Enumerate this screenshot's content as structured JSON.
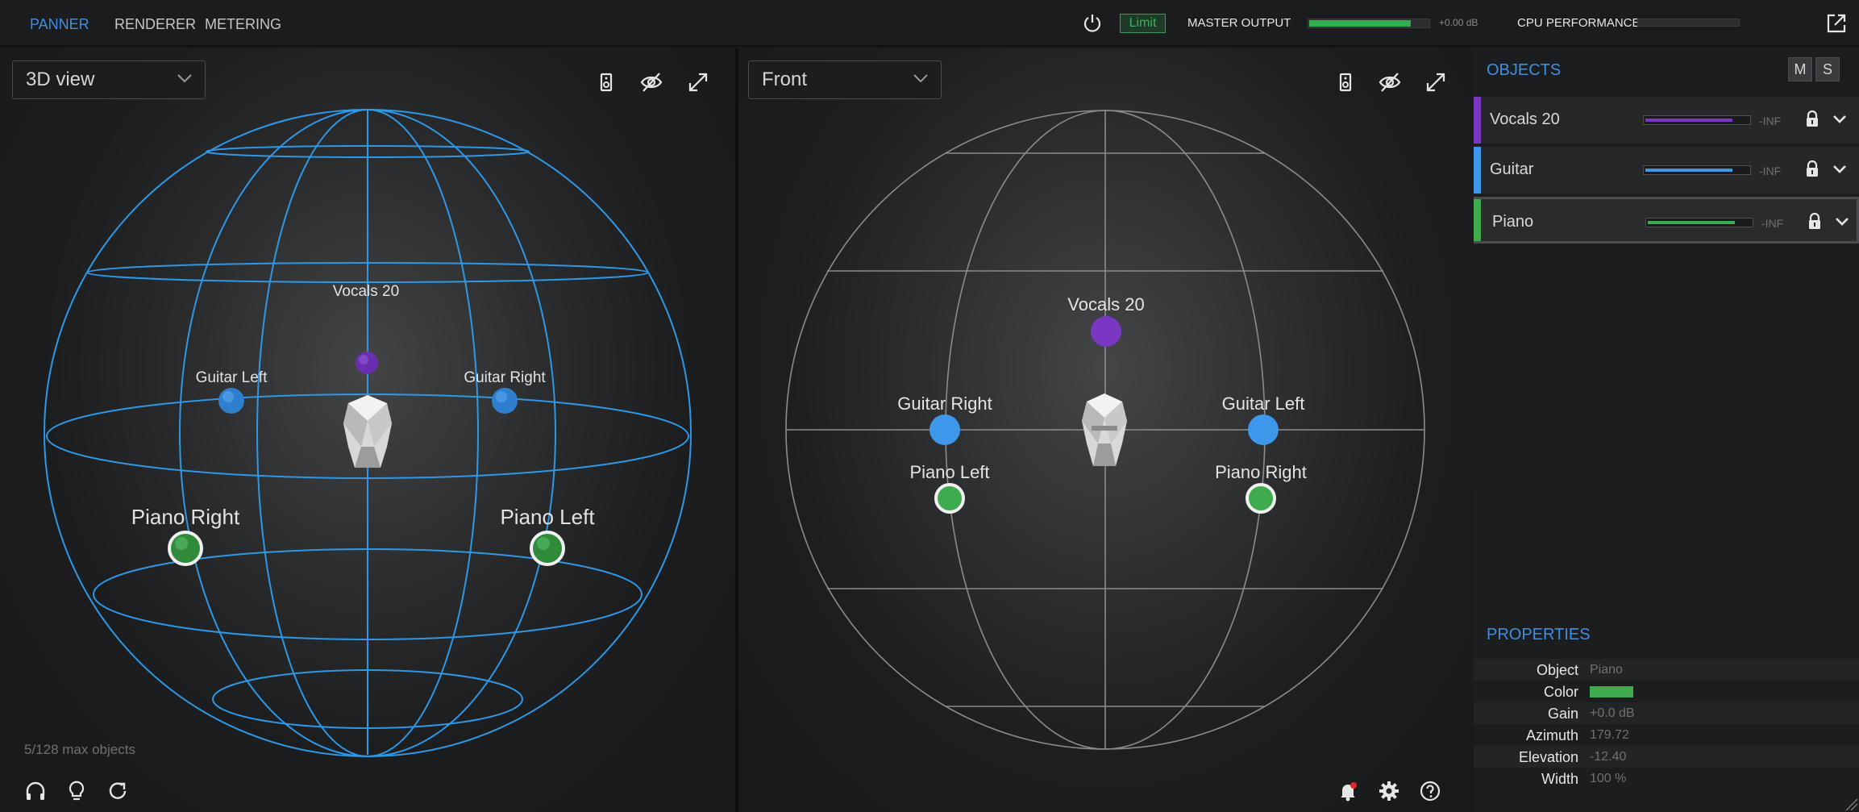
{
  "tabs": [
    {
      "label": "PANNER",
      "active": true
    },
    {
      "label": "RENDERER",
      "active": false
    },
    {
      "label": "METERING",
      "active": false
    }
  ],
  "header": {
    "limit_label": "Limit",
    "master_label": "MASTER OUTPUT",
    "master_level": 0.84,
    "master_db": "+0.00 dB",
    "cpu_label": "CPU PERFORMANCE",
    "cpu_level": 0.0
  },
  "views": {
    "left": {
      "mode": "3D view"
    },
    "right": {
      "mode": "Front"
    }
  },
  "object_count": "5/128 max objects",
  "colors": {
    "accent": "#3f8fe0",
    "vocals": "#7a38c2",
    "guitar": "#3d97ea",
    "piano": "#3dab4e"
  },
  "objects": [
    {
      "name": "Vocals 20",
      "color": "#7a38c2",
      "level": 0.83,
      "db": "-INF",
      "selected": false
    },
    {
      "name": "Guitar",
      "color": "#3d97ea",
      "level": 0.83,
      "db": "-INF",
      "selected": false
    },
    {
      "name": "Piano",
      "color": "#3dab4e",
      "level": 0.83,
      "db": "-INF",
      "selected": true
    }
  ],
  "panel": {
    "objects_title": "OBJECTS",
    "mute_label": "M",
    "solo_label": "S",
    "properties_title": "PROPERTIES"
  },
  "properties": [
    {
      "label": "Object",
      "value": "Piano"
    },
    {
      "label": "Color",
      "value": "",
      "swatch": "#3dab4e"
    },
    {
      "label": "Gain",
      "value": "+0.0 dB"
    },
    {
      "label": "Azimuth",
      "value": "179.72"
    },
    {
      "label": "Elevation",
      "value": "-12.40"
    },
    {
      "label": "Width",
      "value": "100 %"
    }
  ],
  "scene_3d_labels": {
    "vocals": "Vocals 20",
    "guitar_left": "Guitar Left",
    "guitar_right": "Guitar Right",
    "piano_right": "Piano Right",
    "piano_left": "Piano Left"
  },
  "scene_front_labels": {
    "vocals": "Vocals 20",
    "guitar_right": "Guitar Right",
    "guitar_left": "Guitar Left",
    "piano_left": "Piano Left",
    "piano_right": "Piano Right"
  },
  "icons": {
    "power": "power-icon",
    "popout": "popout-icon",
    "speaker": "speaker-icon",
    "hide": "eye-off-icon",
    "fullscreen": "expand-icon",
    "headphones": "headphones-icon",
    "tips": "lightbulb-icon",
    "reset": "refresh-icon",
    "notifications": "bell-icon",
    "settings": "gear-icon",
    "help": "help-icon",
    "lock": "lock-icon"
  }
}
